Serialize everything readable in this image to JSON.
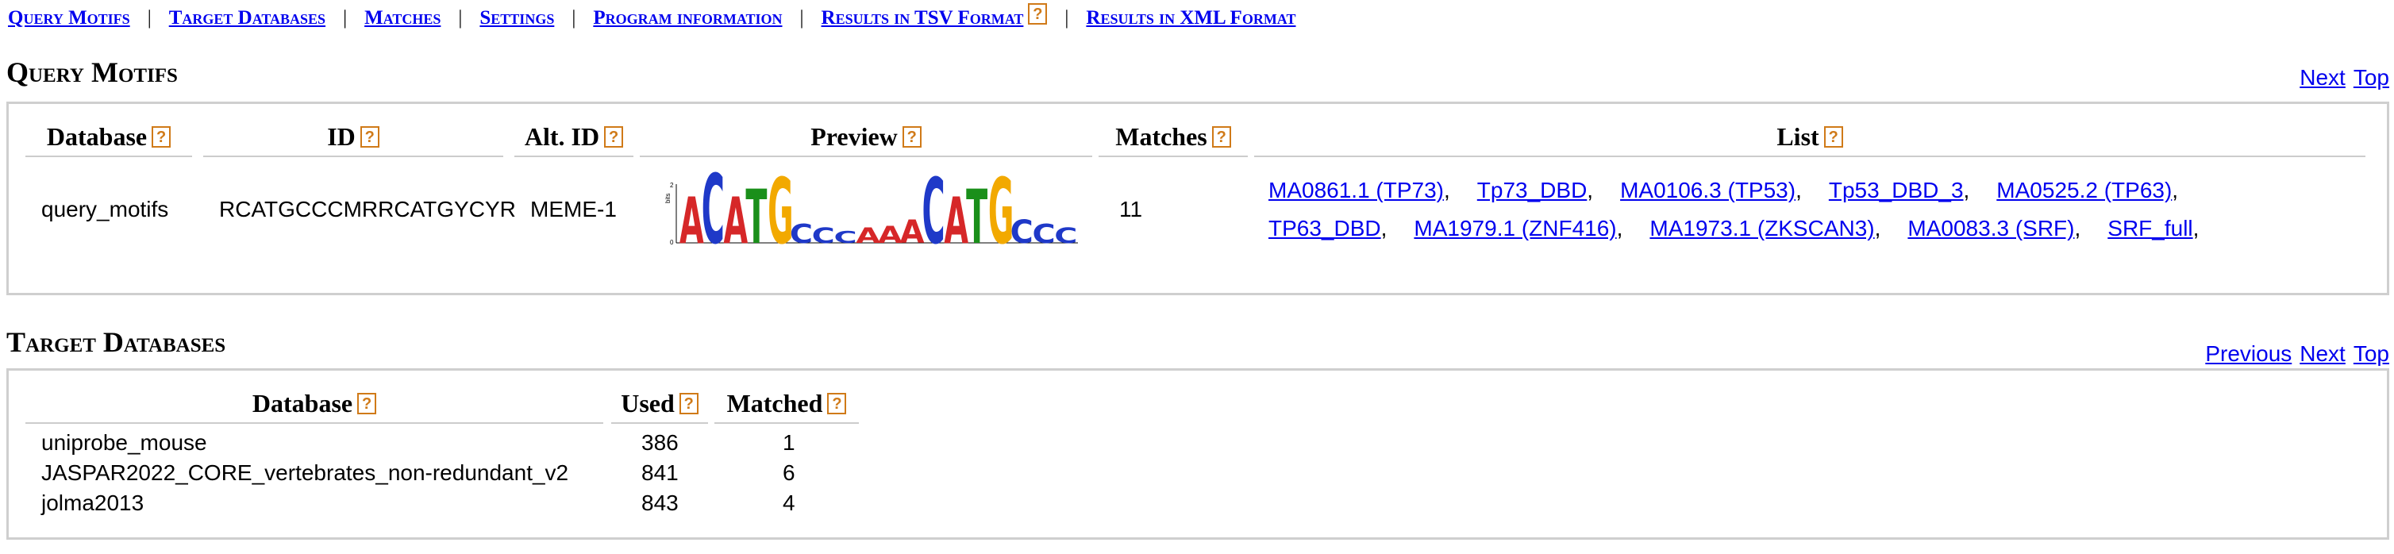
{
  "nav": {
    "items": [
      {
        "label": "Query Motifs"
      },
      {
        "label": "Target Databases"
      },
      {
        "label": "Matches"
      },
      {
        "label": "Settings"
      },
      {
        "label": "Program information"
      },
      {
        "label": "Results in TSV Format"
      },
      {
        "label": "Results in XML Format"
      }
    ],
    "separator": "|",
    "help_glyph": "?"
  },
  "query_motifs": {
    "title": "Query Motifs",
    "links": {
      "next": "Next",
      "top": "Top"
    },
    "headers": {
      "database": "Database",
      "id": "ID",
      "alt_id": "Alt. ID",
      "preview": "Preview",
      "matches": "Matches",
      "list": "List"
    },
    "row": {
      "database": "query_motifs",
      "id": "RCATGCCCMRRCATGYCYR",
      "alt_id": "MEME-1",
      "matches": "11",
      "list_line1": [
        "MA0861.1 (TP73)",
        "Tp73_DBD",
        "MA0106.3 (TP53)",
        "Tp53_DBD_3",
        "MA0525.2 (TP63)"
      ],
      "list_line2": [
        "TP63_DBD",
        "MA1979.1 (ZNF416)",
        "MA1973.1 (ZKSCAN3)",
        "MA0083.3 (SRF)",
        "SRF_full"
      ]
    },
    "logo": {
      "letters": [
        "A",
        "C",
        "A",
        "T",
        "G",
        "C",
        "C",
        "C",
        "A",
        "A",
        "A",
        "C",
        "A",
        "T",
        "G",
        "C",
        "C",
        "C"
      ],
      "colors": {
        "A": "#d62728",
        "C": "#1f39c8",
        "G": "#f2a900",
        "T": "#1a8f1a"
      },
      "y_axis_label": "bits",
      "y_ticks": [
        "2",
        "0"
      ]
    }
  },
  "target_databases": {
    "title": "Target Databases",
    "links": {
      "previous": "Previous",
      "next": "Next",
      "top": "Top"
    },
    "headers": {
      "database": "Database",
      "used": "Used",
      "matched": "Matched"
    },
    "rows": [
      {
        "database": "uniprobe_mouse",
        "used": "386",
        "matched": "1"
      },
      {
        "database": "JASPAR2022_CORE_vertebrates_non-redundant_v2",
        "used": "841",
        "matched": "6"
      },
      {
        "database": "jolma2013",
        "used": "843",
        "matched": "4"
      }
    ]
  }
}
